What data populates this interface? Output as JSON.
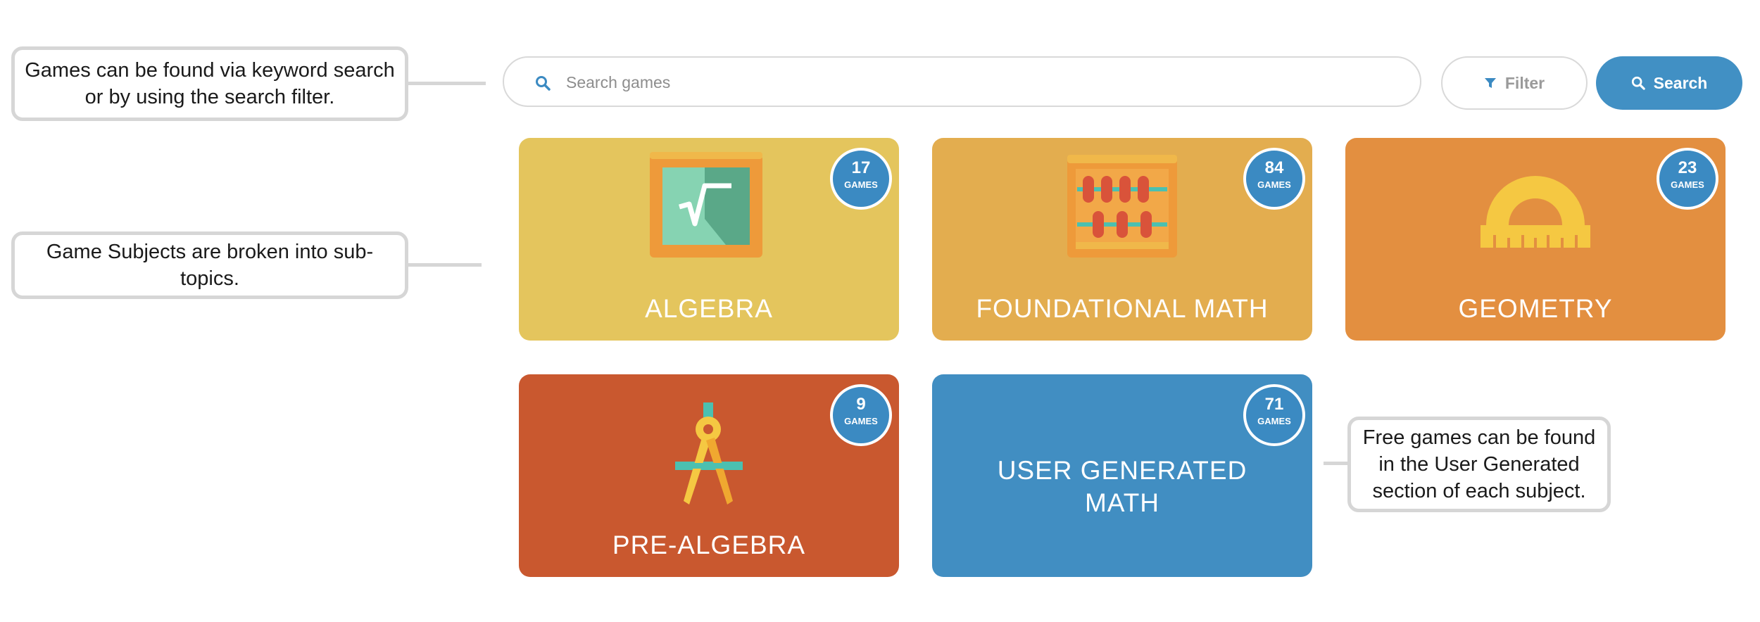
{
  "annotations": {
    "search_note": "Games can be found via keyword search or by using the search filter.",
    "subjects_note": "Game Subjects are broken into sub-topics.",
    "user_generated_note": "Free games can be found in the User Generated section of each subject."
  },
  "search": {
    "placeholder": "Search games",
    "filter_label": "Filter",
    "search_label": "Search"
  },
  "subjects": [
    {
      "name": "ALGEBRA",
      "count": "17",
      "unit": "GAMES",
      "color": "#e4c55d",
      "icon": "square-root-icon"
    },
    {
      "name": "FOUNDATIONAL MATH",
      "count": "84",
      "unit": "GAMES",
      "color": "#e3ad4f",
      "icon": "abacus-icon"
    },
    {
      "name": "GEOMETRY",
      "count": "23",
      "unit": "GAMES",
      "color": "#e38f40",
      "icon": "protractor-icon"
    },
    {
      "name": "PRE-ALGEBRA",
      "count": "9",
      "unit": "GAMES",
      "color": "#c9582f",
      "icon": "compass-icon"
    },
    {
      "name_line1": "USER GENERATED",
      "name_line2": "MATH",
      "count": "71",
      "unit": "GAMES",
      "color": "#418ec2"
    }
  ]
}
